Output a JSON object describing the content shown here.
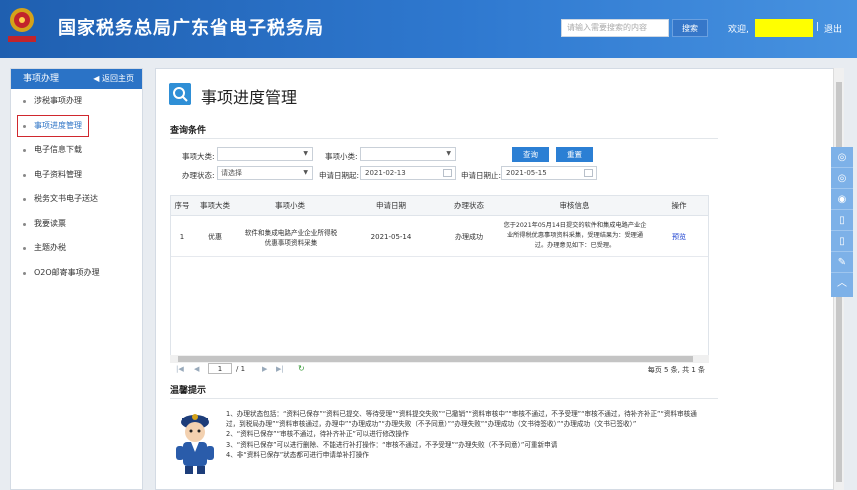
{
  "header": {
    "title": "国家税务总局广东省电子税务局",
    "search_placeholder": "请输入需要搜索的内容",
    "search_button": "搜索",
    "welcome": "欢迎,",
    "separator": "|",
    "logout": "退出"
  },
  "sidebar": {
    "heading": "事项办理",
    "back": "返回主页",
    "items": [
      {
        "label": "涉税事项办理"
      },
      {
        "label": "事项进度管理"
      },
      {
        "label": "电子信息下载"
      },
      {
        "label": "电子资料管理"
      },
      {
        "label": "税务文书电子送达"
      },
      {
        "label": "我要读票"
      },
      {
        "label": "主题办税"
      },
      {
        "label": "O2O邮寄事项办理"
      }
    ]
  },
  "main": {
    "title": "事项进度管理",
    "conditions_title": "查询条件",
    "filters": {
      "major_label": "事项大类:",
      "major_value": "",
      "minor_label": "事项小类:",
      "minor_value": "",
      "status_label": "办理状态:",
      "status_value": "请选择",
      "start_label": "申请日期起:",
      "start_value": "2021-02-13",
      "end_label": "申请日期止:",
      "end_value": "2021-05-15",
      "query_button": "查询",
      "reset_button": "重置"
    },
    "table": {
      "headers": [
        "序号",
        "事项大类",
        "事项小类",
        "申请日期",
        "办理状态",
        "审核信息",
        "操作"
      ],
      "rows": [
        {
          "no": "1",
          "major": "优惠",
          "minor": "软件和集成电路产业企业所得税优惠事项资料采集",
          "date": "2021-05-14",
          "status": "办理成功",
          "info": "您于2021年05月14日提交的软件和集成电路产业企业所得税优惠事项资料采集，受理结果为：受理通过。办理意见如下：已受理。",
          "action": "预览"
        }
      ]
    },
    "pager": {
      "page": "1",
      "total_pages": "/ 1",
      "summary": "每页 5 条, 共 1 条"
    },
    "tips_title": "温馨提示",
    "tips": [
      "1、办理状态包括：“资料已保存”“资料已提交、等待受理”“资料提交失败”“已撤销”“资料审核中”“审核不通过，不予受理”“审核不通过，待补齐补正”“资料审核通过，到税局办理”“资料审核通过，办理中”“办理成功”“办理失败（不予同意）”“办理失败”“办理成功（文书待签收）”“办理成功（文书已签收）”",
      "2、“资料已保存”“审核不通过，待补齐补正”可以进行修改操作",
      "3、“资料已保存”可以进行删除、不能进行补打操作：“审核不通过，不予受理”“办理失败（不予同意）”可重新申请",
      "4、非“资料已保存”状态都可进行申请单补打操作"
    ]
  },
  "colors": {
    "header_blue": "#2f79d0",
    "accent": "#2b7fd4",
    "highlight_yellow": "#ffff00",
    "active_border": "#d0282e"
  },
  "icons": [
    "emblem-icon",
    "back-icon",
    "search-icon",
    "calendar-icon",
    "refresh-icon",
    "officer-icon",
    "chat-icon",
    "weibo-icon",
    "phone-icon",
    "mobile-icon",
    "edit-icon",
    "up-icon"
  ]
}
